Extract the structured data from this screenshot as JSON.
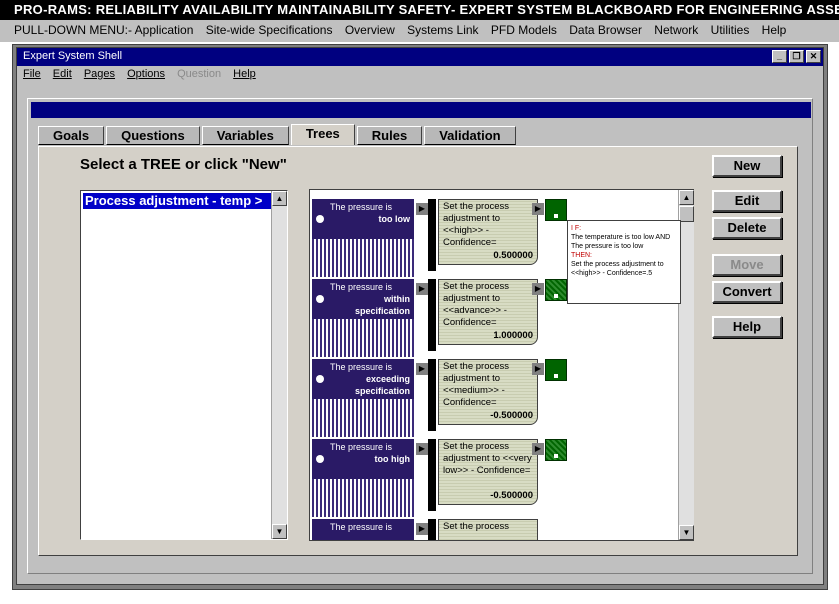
{
  "app": {
    "title": "PRO-RAMS: RELIABILITY AVAILABILITY MAINTAINABILITY SAFETY- EXPERT SYSTEM BLACKBOARD FOR ENGINEERING ASSETS"
  },
  "menu_strip": {
    "items": [
      "PULL-DOWN MENU:- Application",
      "Site-wide Specifications",
      "Overview",
      "Systems Link",
      "PFD Models",
      "Data Browser",
      "Network",
      "Utilities",
      "Help"
    ]
  },
  "window": {
    "title": "Expert System Shell",
    "controls": [
      "_",
      "❐",
      "✕"
    ],
    "menu": [
      {
        "label": "File",
        "enabled": true
      },
      {
        "label": "Edit",
        "enabled": true
      },
      {
        "label": "Pages",
        "enabled": true
      },
      {
        "label": "Options",
        "enabled": true
      },
      {
        "label": "Question",
        "enabled": false
      },
      {
        "label": "Help",
        "enabled": true
      }
    ]
  },
  "tabs": [
    {
      "label": "Goals",
      "active": false
    },
    {
      "label": "Questions",
      "active": false
    },
    {
      "label": "Variables",
      "active": false
    },
    {
      "label": "Trees",
      "active": true
    },
    {
      "label": "Rules",
      "active": false
    },
    {
      "label": "Validation",
      "active": false
    }
  ],
  "instruction": "Select a TREE or click \"New\"",
  "tree_list": {
    "items": [
      "Process adjustment - temp >"
    ],
    "selected_index": 0
  },
  "tree": {
    "nodes": [
      {
        "condition_prefix": "The pressure is",
        "condition_value": "too low",
        "conclusion": "Set the process adjustment to <<high>> - Confidence=",
        "confidence": "0.500000"
      },
      {
        "condition_prefix": "The pressure is",
        "condition_value": "within specification",
        "conclusion": "Set the process adjustment to <<advance>> - Confidence=",
        "confidence": "1.000000"
      },
      {
        "condition_prefix": "The pressure is",
        "condition_value": "exceeding specification",
        "conclusion": "Set the process adjustment to <<medium>> - Confidence=",
        "confidence": "-0.500000"
      },
      {
        "condition_prefix": "The pressure is",
        "condition_value": "too high",
        "conclusion": "Set the process adjustment to <<very low>> - Confidence=",
        "confidence": "-0.500000"
      },
      {
        "condition_prefix": "The pressure is",
        "condition_value": "",
        "conclusion": "Set the process",
        "confidence": ""
      }
    ],
    "tooltip": {
      "if_label": "I F:",
      "if_text": "The temperature is too low AND The pressure is too low",
      "then_label": "THEN:",
      "then_text": "Set the process adjustment to <<high>> - Confidence=.5"
    }
  },
  "buttons": [
    {
      "label": "New",
      "enabled": true
    },
    {
      "label": "Edit",
      "enabled": true
    },
    {
      "label": "Delete",
      "enabled": true
    },
    {
      "label": "Move",
      "enabled": false
    },
    {
      "label": "Convert",
      "enabled": true
    },
    {
      "label": "Help",
      "enabled": true
    }
  ],
  "colors": {
    "title_bar": "#000080",
    "selection": "#0000c8",
    "condition_node": "#2a1a66",
    "rule_node": "#006400"
  },
  "icons": [
    "minimize-icon",
    "restore-icon",
    "close-icon",
    "scroll-up-icon",
    "scroll-down-icon",
    "arrow-right-icon"
  ]
}
